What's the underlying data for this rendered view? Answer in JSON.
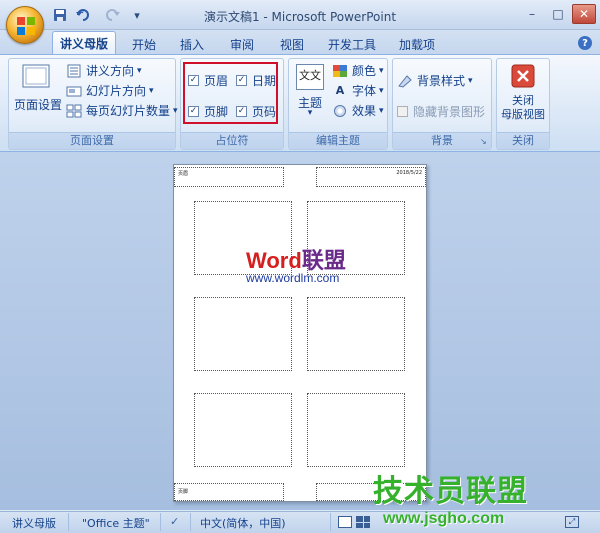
{
  "window": {
    "title": "演示文稿1 - Microsoft PowerPoint"
  },
  "quick_access": {
    "icons": [
      "save-icon",
      "undo-icon",
      "redo-icon",
      "customize-icon"
    ]
  },
  "tabs": [
    {
      "label": "讲义母版",
      "active": true
    },
    {
      "label": "开始"
    },
    {
      "label": "插入"
    },
    {
      "label": "审阅"
    },
    {
      "label": "视图"
    },
    {
      "label": "开发工具"
    },
    {
      "label": "加载项"
    }
  ],
  "ribbon": {
    "page_setup": {
      "group_label": "页面设置",
      "page_setup_button": "页面设置",
      "handout_orientation": "讲义方向",
      "slide_orientation": "幻灯片方向",
      "slides_per_page": "每页幻灯片数量"
    },
    "placeholders": {
      "group_label": "占位符",
      "header": {
        "label": "页眉",
        "checked": true
      },
      "date": {
        "label": "日期",
        "checked": true
      },
      "footer": {
        "label": "页脚",
        "checked": true
      },
      "page_number": {
        "label": "页码",
        "checked": true
      }
    },
    "edit_theme": {
      "group_label": "编辑主题",
      "theme_icon_text": "文文",
      "theme_button": "主题",
      "colors": "颜色",
      "fonts": "字体",
      "effects": "效果"
    },
    "background": {
      "group_label": "背景",
      "background_styles": "背景样式",
      "hide_background_graphics": "隐藏背景图形",
      "hide_background_checked": false
    },
    "close": {
      "group_label": "关闭",
      "close_master_view_line1": "关闭",
      "close_master_view_line2": "母版视图"
    }
  },
  "handout_page": {
    "header_text": "页眉",
    "date_text": "2018/5/22",
    "footer_text": "页脚"
  },
  "watermarks": {
    "word_lianmeng": {
      "word": "Word",
      "lianmeng": "联盟"
    },
    "wordlm_url": "www.wordlm.com",
    "jishuyuan": "技术员联盟",
    "jsgho_url": "www.jsgho.com"
  },
  "statusbar": {
    "view": "讲义母版",
    "theme": "\"Office 主题\"",
    "language": "中文(简体，中国)"
  },
  "colors": {
    "accent": "#15428b",
    "highlight_box": "#d0102a",
    "watermark_green": "#36b12c"
  }
}
